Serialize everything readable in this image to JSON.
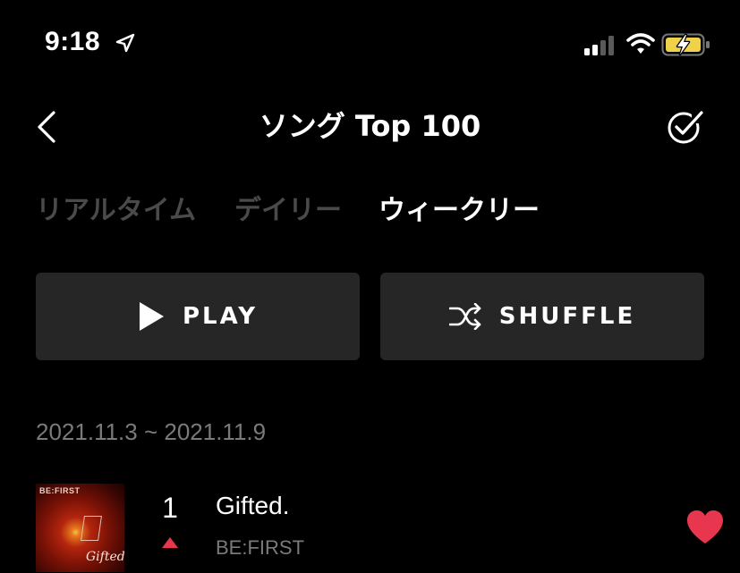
{
  "status_bar": {
    "time": "9:18",
    "icons": [
      "location-arrow-icon",
      "cellular-signal-icon",
      "wifi-icon",
      "battery-charging-icon"
    ],
    "battery_color": "#f0d14a"
  },
  "header": {
    "title": "ソング Top 100",
    "back_icon": "chevron-left-icon",
    "select_icon": "check-circle-icon"
  },
  "tabs": [
    {
      "label": "リアルタイム",
      "active": false
    },
    {
      "label": "デイリー",
      "active": false
    },
    {
      "label": "ウィークリー",
      "active": true
    }
  ],
  "actions": {
    "play_label": "PLAY",
    "shuffle_label": "SHUFFLE"
  },
  "chart_period": "2021.11.3 ~ 2021.11.9",
  "tracks": [
    {
      "rank": "1",
      "title": "Gifted.",
      "artist": "BE:FIRST",
      "rank_change": "up",
      "favorited": true,
      "art_text": "BE:FIRST",
      "art_signature": "Gifted."
    }
  ],
  "colors": {
    "background": "#000000",
    "button_bg": "#262626",
    "inactive_tab": "#4a4a4a",
    "secondary_text": "#7a7a7a",
    "accent_red": "#e8364f"
  }
}
